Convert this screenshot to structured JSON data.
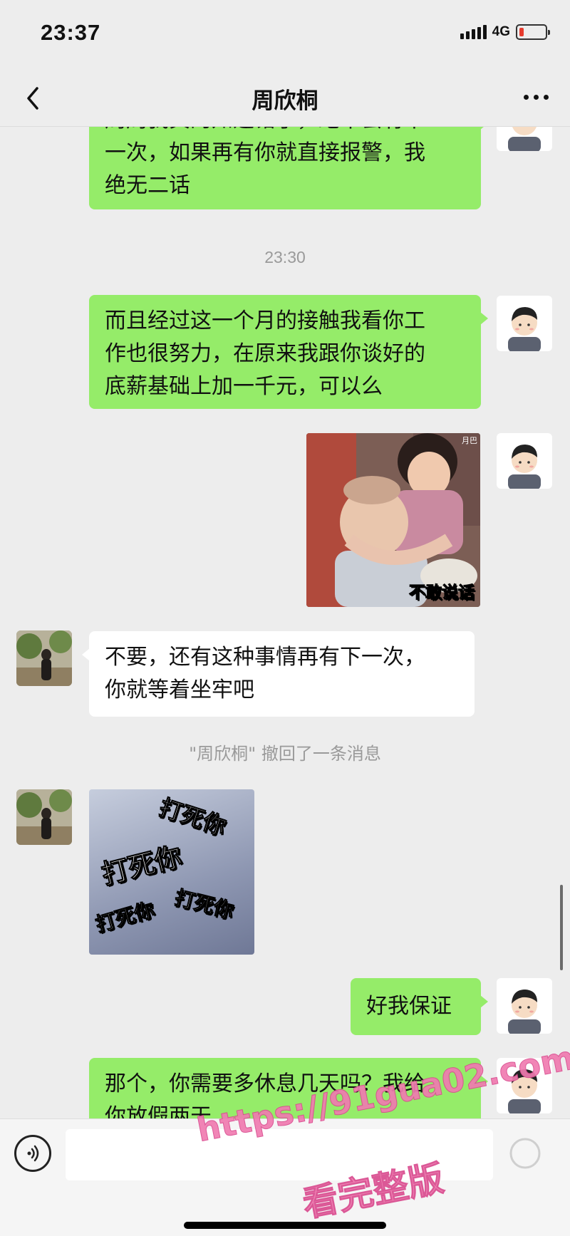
{
  "status_bar": {
    "time": "23:37",
    "network": "4G",
    "battery_color": "#e63b2e"
  },
  "nav": {
    "title": "周欣桐"
  },
  "messages": {
    "m1": {
      "line_partial": "周周我真的知道错了，绝不会有下",
      "line2": "一次，如果再有你就直接报警，我",
      "line3": "绝无二话"
    },
    "timestamp": "23:30",
    "m2": {
      "line1": "而且经过这一个月的接触我看你工",
      "line2": "作也很努力，在原来我跟你谈好的",
      "line3": "底薪基础上加一千元，可以么"
    },
    "sticker1": {
      "caption": "不敢说话",
      "corner": "月巴"
    },
    "m3": {
      "line1": "不要，还有这种事情再有下一次，",
      "line2": "你就等着坐牢吧"
    },
    "recall_notice": "\"周欣桐\" 撤回了一条消息",
    "sticker2": {
      "caption": "打死你"
    },
    "m4": {
      "text": "好我保证"
    },
    "m5": {
      "line1": "那个，你需要多休息几天吗？我给",
      "line2_partial": "你放假两天"
    }
  },
  "watermark": {
    "url": "https://91gua02.com",
    "note": "看完整版"
  },
  "colors": {
    "bubble_me": "#95ec69",
    "bubble_her": "#ffffff",
    "background": "#ededed",
    "watermark": "#f07bb0"
  },
  "icons": {
    "back": "chevron-left-icon",
    "more": "more-dots-icon",
    "voice": "voice-icon",
    "emoji": "emoji-icon"
  }
}
